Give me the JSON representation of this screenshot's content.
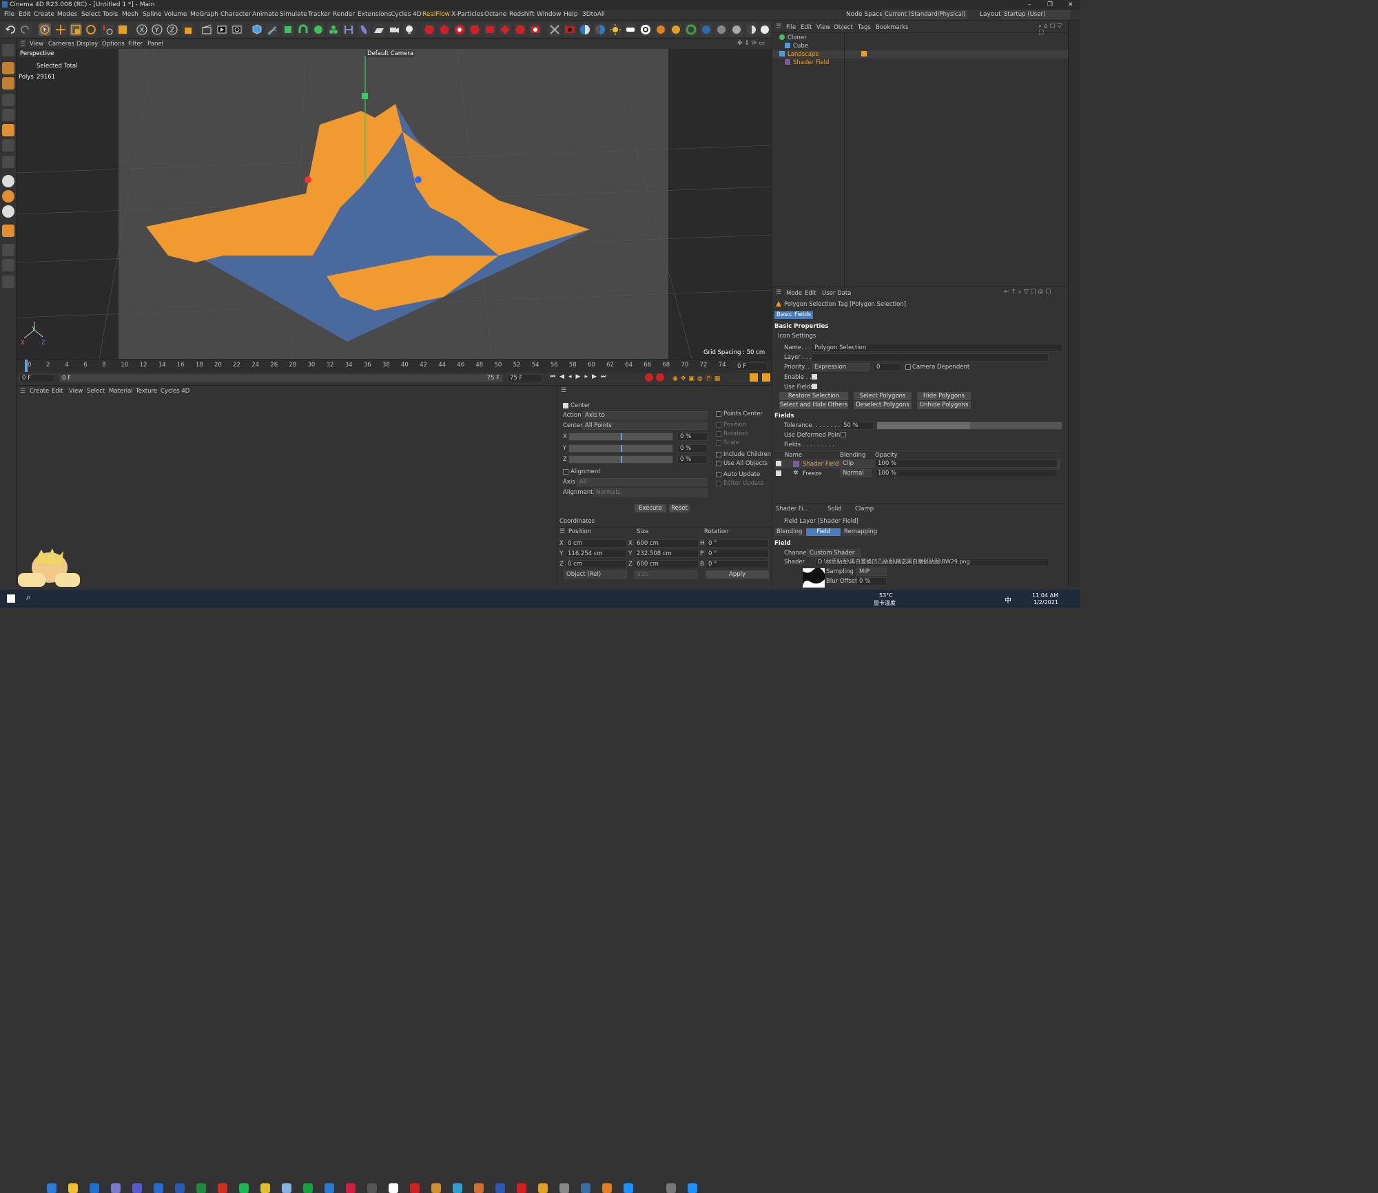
{
  "window": {
    "title": "Cinema 4D R23.008 (RC) - [Untitled 1 *] - Main"
  },
  "menu": [
    "File",
    "Edit",
    "Create",
    "Modes",
    "Select",
    "Tools",
    "Mesh",
    "Spline",
    "Volume",
    "MoGraph",
    "Character",
    "Animate",
    "Simulate",
    "Tracker",
    "Render",
    "Extensions",
    "Cycles 4D",
    "RealFlow",
    "X-Particles",
    "Octane",
    "Redshift",
    "Window",
    "Help",
    "3DtoAll"
  ],
  "nodespace": {
    "label": "Node Space:",
    "value": "Current (Standard/Physical)"
  },
  "layout": {
    "label": "Layout:",
    "value": "Startup (User)"
  },
  "viewport": {
    "menu": [
      "View",
      "Cameras",
      "Display",
      "Options",
      "Filter",
      "Panel"
    ],
    "name": "Perspective",
    "camera": "Default Camera",
    "stats_header": "Selected Total",
    "stats_label": "Polys",
    "stats_value": "29161",
    "grid_spacing": "Grid Spacing : 50 cm",
    "axis_labels": [
      "Y",
      "X",
      "Z"
    ]
  },
  "timeline": {
    "ticks": [
      "0",
      "2",
      "4",
      "6",
      "8",
      "10",
      "12",
      "14",
      "16",
      "18",
      "20",
      "22",
      "24",
      "26",
      "28",
      "30",
      "32",
      "34",
      "36",
      "38",
      "40",
      "42",
      "44",
      "46",
      "48",
      "50",
      "52",
      "54",
      "56",
      "58",
      "60",
      "62",
      "64",
      "66",
      "68",
      "70",
      "72",
      "74"
    ],
    "current": "0 F",
    "start": "0 F",
    "range_start": "0 F",
    "range_end": "75 F",
    "end": "75 F"
  },
  "material_menu": [
    "Create",
    "Edit",
    "View",
    "Select",
    "Material",
    "Texture",
    "Cycles 4D"
  ],
  "tool": {
    "center_label": "Center",
    "action_label": "Action",
    "action_value": "Axis to",
    "center_field_label": "Center",
    "center_value": "All Points",
    "x_label": "X",
    "x_value": "0 %",
    "y_label": "Y",
    "y_value": "0 %",
    "z_label": "Z",
    "z_value": "0 %",
    "alignment_label": "Alignment",
    "axis_label": "Axis",
    "axis_value": "All",
    "alignment_field_label": "Alignment",
    "alignment_value": "Normals",
    "points_center": "Points Center",
    "position": "Position",
    "rotation": "Rotation",
    "scale": "Scale",
    "include_children": "Include Children",
    "use_all_objects": "Use All Objects",
    "auto_update": "Auto Update",
    "editor_update": "Editor Update",
    "execute": "Execute",
    "reset": "Reset"
  },
  "coordinates": {
    "title": "Coordinates",
    "headers": [
      "Position",
      "Size",
      "Rotation"
    ],
    "rows": [
      {
        "a": "X",
        "pos": "0 cm",
        "b": "X",
        "size": "600 cm",
        "c": "H",
        "rot": "0 °"
      },
      {
        "a": "Y",
        "pos": "116.254 cm",
        "b": "Y",
        "size": "232.508 cm",
        "c": "P",
        "rot": "0 °"
      },
      {
        "a": "Z",
        "pos": "0 cm",
        "b": "Z",
        "size": "600 cm",
        "c": "B",
        "rot": "0 °"
      }
    ],
    "mode": "Object (Rel)",
    "size_mode": "Size",
    "apply": "Apply"
  },
  "objects": {
    "menu": [
      "File",
      "Edit",
      "View",
      "Object",
      "Tags",
      "Bookmarks"
    ],
    "items": [
      {
        "name": "Cloner",
        "color": "#d0d0d0"
      },
      {
        "name": "Cube",
        "color": "#d0d0d0"
      },
      {
        "name": "Landscape",
        "color": "#f0a030"
      },
      {
        "name": "Shader Field",
        "color": "#f0a030"
      }
    ]
  },
  "attributes": {
    "menu": [
      "Mode",
      "Edit",
      "User Data"
    ],
    "title": "Polygon Selection Tag [Polygon Selection]",
    "tabs": [
      "Basic",
      "Fields"
    ],
    "section_basic": "Basic Properties",
    "icon_settings": "Icon Settings",
    "name_label": "Name. . . .",
    "name_value": "Polygon Selection",
    "layer_label": "Layer . . .",
    "priority_label": "Priority. . .",
    "priority_value": "Expression",
    "priority_num": "0",
    "camera_dependent": "Camera Dependent",
    "enable_label": "Enable . . .",
    "use_fields_label": "Use Fields",
    "buttons": [
      "Restore Selection",
      "Select Polygons",
      "Hide Polygons",
      "Select and Hide Others",
      "Deselect Polygons",
      "Unhide Polygons"
    ],
    "section_fields": "Fields",
    "tolerance_label": "Tolerance. . . . . . . .",
    "tolerance_value": "50 %",
    "tolerance": 0.5,
    "use_deformed": "Use Deformed Points",
    "fields_label": "Fields . . . . . . . . .",
    "field_headers": [
      "Name",
      "Blending",
      "Opacity"
    ],
    "field_rows": [
      {
        "name": "Shader Field",
        "blend": "Clip",
        "opacity": "100 %",
        "color": "#f0a030"
      },
      {
        "name": "Freeze",
        "blend": "Normal",
        "opacity": "100 %",
        "color": "#d0d0d0"
      }
    ],
    "layer_tabs": [
      "Shader Fi...",
      "Solid",
      "Clamp"
    ],
    "layer_title": "Field Layer [Shader Field]",
    "layer_subtabs": [
      "Blending",
      "Field",
      "Remapping"
    ],
    "field_section": "Field",
    "channel_label": "Channel",
    "channel_value": "Custom Shader",
    "shader_label": "Shader",
    "shader_path": "D:\\材质贴图\\黑白置换凹凸贴图\\精选黑白磨损贴图\\BW29.png",
    "sampling_label": "Sampling",
    "sampling_value": "MIP",
    "blur_label": "Blur Offset",
    "blur_value": "0 %"
  },
  "taskbar": {
    "temp": "53°C",
    "temp_label": "显卡温度",
    "time": "11:04 AM",
    "date": "1/2/2021",
    "ime": "中"
  }
}
